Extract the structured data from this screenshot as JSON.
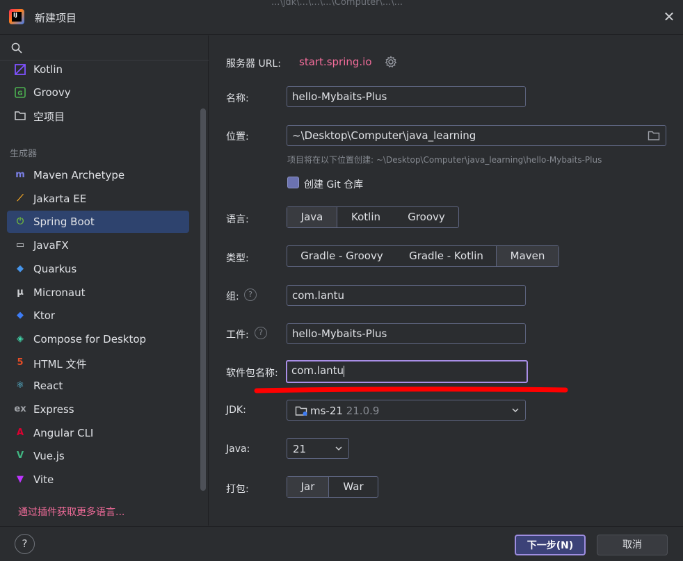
{
  "window": {
    "title": "新建项目",
    "background_text": "...\\jdk\\...\\...\\...\\Computer\\...\\..."
  },
  "sidebar": {
    "languages": [
      {
        "label": "Kotlin",
        "icon": "kotlin-icon",
        "color": "#7f52ff"
      },
      {
        "label": "Groovy",
        "icon": "groovy-icon",
        "color": "#4cb050"
      },
      {
        "label": "空项目",
        "icon": "empty-project-icon",
        "color": "#cfd1d4"
      }
    ],
    "generators_label": "生成器",
    "generators": [
      {
        "label": "Maven Archetype",
        "icon": "maven-icon",
        "glyph": "m",
        "color": "#7b80e8"
      },
      {
        "label": "Jakarta EE",
        "icon": "jakarta-icon",
        "glyph": "⟋",
        "color": "#f5a623"
      },
      {
        "label": "Spring Boot",
        "icon": "spring-boot-icon",
        "glyph": "⏻",
        "color": "#6db33f"
      },
      {
        "label": "JavaFX",
        "icon": "javafx-icon",
        "glyph": "▭",
        "color": "#cfd1d4"
      },
      {
        "label": "Quarkus",
        "icon": "quarkus-icon",
        "glyph": "◆",
        "color": "#4695eb"
      },
      {
        "label": "Micronaut",
        "icon": "micronaut-icon",
        "glyph": "μ",
        "color": "#cfd1d4"
      },
      {
        "label": "Ktor",
        "icon": "ktor-icon",
        "glyph": "◆",
        "color": "#3d7cf5"
      },
      {
        "label": "Compose for Desktop",
        "icon": "compose-icon",
        "glyph": "◈",
        "color": "#41d4a8"
      },
      {
        "label": "HTML 文件",
        "icon": "html5-icon",
        "glyph": "5",
        "color": "#e44d26"
      },
      {
        "label": "React",
        "icon": "react-icon",
        "glyph": "⚛",
        "color": "#61dafb"
      },
      {
        "label": "Express",
        "icon": "express-icon",
        "glyph": "ex",
        "color": "#a0a3a8"
      },
      {
        "label": "Angular CLI",
        "icon": "angular-icon",
        "glyph": "A",
        "color": "#dd0031"
      },
      {
        "label": "Vue.js",
        "icon": "vue-icon",
        "glyph": "V",
        "color": "#41b883"
      },
      {
        "label": "Vite",
        "icon": "vite-icon",
        "glyph": "▼",
        "color": "#bd34fe"
      }
    ],
    "selected": "Spring Boot",
    "plugins_link": "通过插件获取更多语言..."
  },
  "form": {
    "server_url_label": "服务器 URL:",
    "server_url": "start.spring.io",
    "name_label": "名称:",
    "name_value": "hello-Mybaits-Plus",
    "location_label": "位置:",
    "location_value": "~\\Desktop\\Computer\\java_learning",
    "location_hint": "项目将在以下位置创建: ~\\Desktop\\Computer\\java_learning\\hello-Mybaits-Plus",
    "git_label": "创建 Git 仓库",
    "language_label": "语言:",
    "languages": [
      "Java",
      "Kotlin",
      "Groovy"
    ],
    "language_selected": "Java",
    "type_label": "类型:",
    "types": [
      "Gradle - Groovy",
      "Gradle - Kotlin",
      "Maven"
    ],
    "type_selected": "Maven",
    "group_label": "组:",
    "group_value": "com.lantu",
    "artifact_label": "工件:",
    "artifact_value": "hello-Mybaits-Plus",
    "package_label": "软件包名称:",
    "package_value": "com.lantu",
    "jdk_label": "JDK:",
    "jdk_value": "ms-21",
    "jdk_version": "21.0.9",
    "java_label": "Java:",
    "java_value": "21",
    "packaging_label": "打包:",
    "packagings": [
      "Jar",
      "War"
    ],
    "packaging_selected": "Jar",
    "help_mark": "?"
  },
  "footer": {
    "help": "?",
    "next_label": "下一步(N)",
    "cancel_label": "取消"
  },
  "colors": {
    "accent_link": "#f26c9a",
    "selection": "#2e436e",
    "focus_border": "#a98ee6",
    "annotation_red": "#ff0000"
  }
}
